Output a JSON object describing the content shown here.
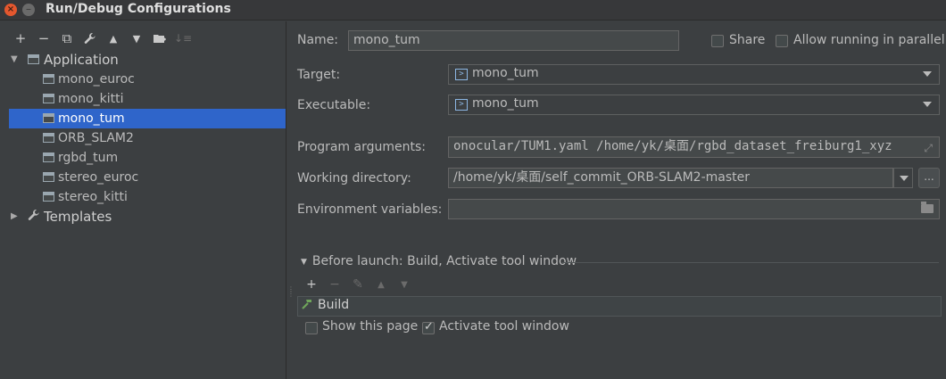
{
  "window": {
    "title": "Run/Debug Configurations"
  },
  "toolbar": {
    "buttons": [
      {
        "name": "add",
        "glyph": "+"
      },
      {
        "name": "remove",
        "glyph": "−"
      },
      {
        "name": "copy",
        "glyph": "⧉"
      },
      {
        "name": "edit-defaults",
        "glyph": "🔧"
      },
      {
        "name": "move-up",
        "glyph": "▲"
      },
      {
        "name": "move-down",
        "glyph": "▼"
      },
      {
        "name": "folder",
        "glyph": "▆"
      },
      {
        "name": "sort",
        "glyph": "↓"
      }
    ]
  },
  "tree": {
    "application_label": "Application",
    "templates_label": "Templates",
    "items": [
      {
        "label": "mono_euroc"
      },
      {
        "label": "mono_kitti"
      },
      {
        "label": "mono_tum",
        "selected": true
      },
      {
        "label": "ORB_SLAM2"
      },
      {
        "label": "rgbd_tum"
      },
      {
        "label": "stereo_euroc"
      },
      {
        "label": "stereo_kitti"
      }
    ]
  },
  "form": {
    "name_label": "Name:",
    "name_value": "mono_tum",
    "share_label": "Share",
    "share_checked": false,
    "parallel_label": "Allow running in parallel",
    "parallel_checked": false,
    "target_label": "Target:",
    "target_value": "mono_tum",
    "executable_label": "Executable:",
    "executable_value": "mono_tum",
    "program_args_label": "Program arguments:",
    "program_args_value": "onocular/TUM1.yaml /home/yk/桌面/rgbd_dataset_freiburg1_xyz",
    "working_dir_label": "Working directory:",
    "working_dir_value": "/home/yk/桌面/self_commit_ORB-SLAM2-master",
    "browse_label": "...",
    "env_vars_label": "Environment variables:",
    "env_vars_value": ""
  },
  "before_launch": {
    "title": "Before launch: Build, Activate tool window",
    "build_label": "Build",
    "show_page_label": "Show this page",
    "show_page_checked": false,
    "activate_label": "Activate tool window",
    "activate_checked": true
  },
  "colors": {
    "background": "#3c3f41",
    "selection": "#2f65ca",
    "input_bg": "#45494a",
    "text": "#bbbbbb"
  }
}
